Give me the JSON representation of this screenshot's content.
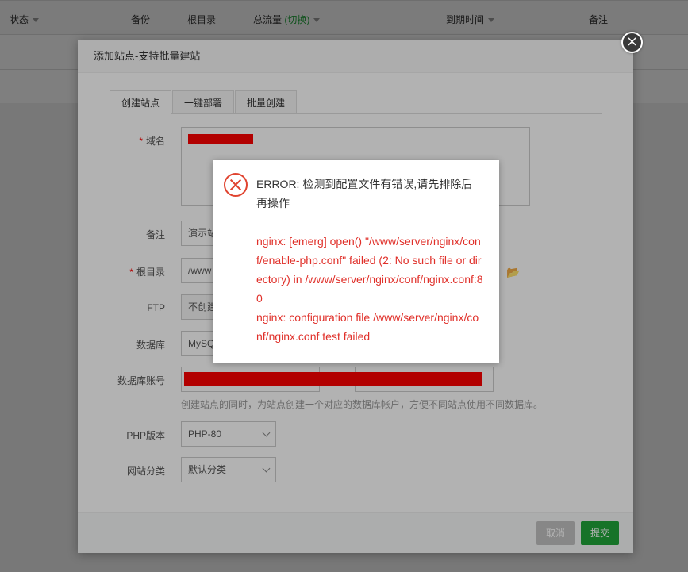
{
  "background": {
    "columns": [
      {
        "label": "状态",
        "has_caret": true
      },
      {
        "label": "备份"
      },
      {
        "label": "根目录"
      },
      {
        "label": "总流量",
        "toggle": "(切换)",
        "has_caret": true
      },
      {
        "label": "到期时间",
        "has_caret": true
      },
      {
        "label": "备注"
      }
    ]
  },
  "dialog": {
    "title": "添加站点-支持批量建站",
    "close_glyph": "×",
    "tabs": [
      "创建站点",
      "一键部署",
      "批量创建"
    ],
    "fields": {
      "domain_label": "域名",
      "remark_label": "备注",
      "remark_value": "演示站",
      "root_label": "根目录",
      "root_value": "/www",
      "ftp_label": "FTP",
      "ftp_value": "不创建",
      "db_label": "数据库",
      "db_value": "MySQL",
      "db_account_label": "数据库账号",
      "db_hint": "创建站点的同时，为站点创建一个对应的数据库帐户，方便不同站点使用不同数据库。",
      "php_label": "PHP版本",
      "php_value": "PHP-80",
      "category_label": "网站分类",
      "category_value": "默认分类",
      "required_mark": "*"
    },
    "buttons": {
      "cancel": "取消",
      "submit": "提交"
    },
    "icons": {
      "folder": "folder-open-icon",
      "close": "close-icon"
    }
  },
  "error": {
    "title": "ERROR: 检测到配置文件有错误,请先排除后再操作",
    "line1": "nginx: [emerg] open() \"/www/server/nginx/conf/enable-php.conf\" failed (2: No such file or directory) in /www/server/nginx/conf/nginx.conf:80",
    "line2": "nginx: configuration file /www/server/nginx/conf/nginx.conf test failed",
    "icon": "error-x-icon",
    "color": "#e0302a"
  }
}
